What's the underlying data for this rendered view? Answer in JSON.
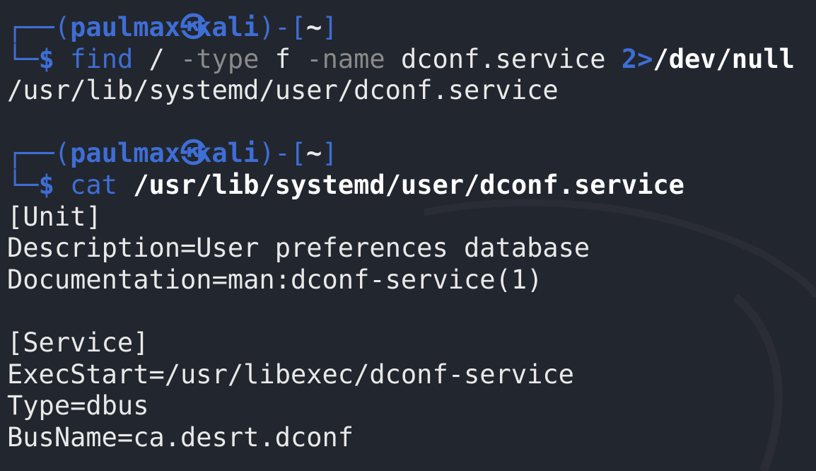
{
  "colors": {
    "background": "#22262e",
    "prompt_blue": "#3e6ed6",
    "text": "#e9e9e9",
    "option_gray": "#8a8a8a"
  },
  "prompt": {
    "user": "paulmax",
    "separator_icon": "kali-at-icon",
    "host": "kali",
    "dir": "~",
    "symbol": "$"
  },
  "cmd1": {
    "program": "find",
    "path": "/",
    "opt_type": "-type",
    "type_val": "f",
    "opt_name": "-name",
    "name_val": "dconf.service",
    "redir": "2>",
    "redir_target": "/dev/null"
  },
  "cmd1_output": "/usr/lib/systemd/user/dconf.service",
  "cmd2": {
    "program": "cat",
    "arg": "/usr/lib/systemd/user/dconf.service"
  },
  "cmd2_output": [
    "[Unit]",
    "Description=User preferences database",
    "Documentation=man:dconf-service(1)",
    "",
    "[Service]",
    "ExecStart=/usr/libexec/dconf-service",
    "Type=dbus",
    "BusName=ca.desrt.dconf"
  ]
}
